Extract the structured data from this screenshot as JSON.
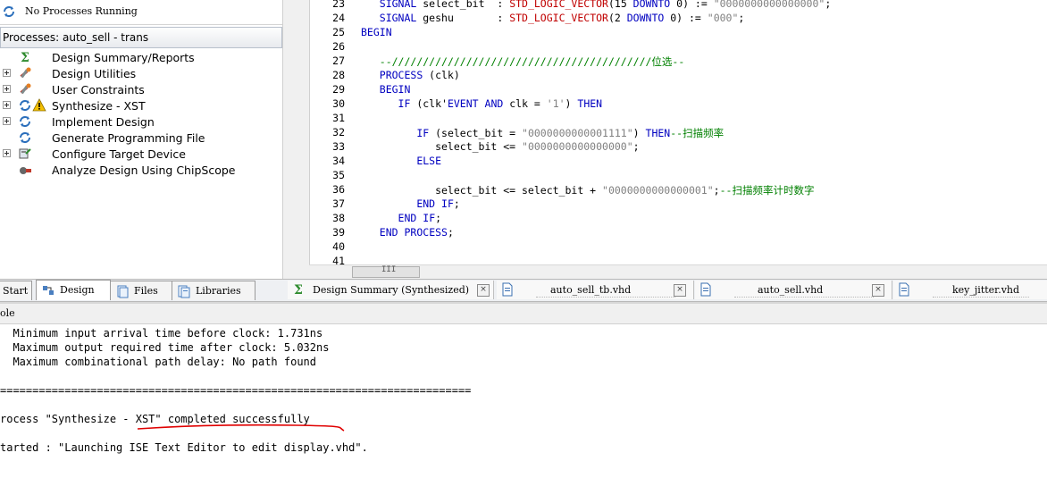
{
  "status": {
    "text": "No Processes Running"
  },
  "processes": {
    "header": "Processes: auto_sell - trans",
    "items": [
      {
        "label": "Design Summary/Reports",
        "icon": "sigma-icon",
        "expandable": false
      },
      {
        "label": "Design Utilities",
        "icon": "tools-icon",
        "expandable": true
      },
      {
        "label": "User Constraints",
        "icon": "tools-icon",
        "expandable": true
      },
      {
        "label": "Synthesize - XST",
        "icon": "refresh-icon",
        "expandable": true,
        "warning": true
      },
      {
        "label": "Implement Design",
        "icon": "refresh-icon",
        "expandable": true
      },
      {
        "label": "Generate Programming File",
        "icon": "refresh-icon",
        "expandable": false
      },
      {
        "label": "Configure Target Device",
        "icon": "device-icon",
        "expandable": true
      },
      {
        "label": "Analyze Design Using ChipScope",
        "icon": "chipscope-icon",
        "expandable": false
      }
    ]
  },
  "editor": {
    "lines": [
      {
        "n": "23",
        "t": [
          [
            "   ",
            ""
          ],
          [
            "SIGNAL",
            "kw"
          ],
          [
            " select_bit  : ",
            ""
          ],
          [
            "STD_LOGIC_VECTOR",
            "ty"
          ],
          [
            "(15 ",
            ""
          ],
          [
            "DOWNTO",
            "kw"
          ],
          [
            " 0) := ",
            ""
          ],
          [
            "\"0000000000000000\"",
            "str"
          ],
          [
            ";",
            ""
          ]
        ]
      },
      {
        "n": "24",
        "t": [
          [
            "   ",
            ""
          ],
          [
            "SIGNAL",
            "kw"
          ],
          [
            " geshu       : ",
            ""
          ],
          [
            "STD_LOGIC_VECTOR",
            "ty"
          ],
          [
            "(2 ",
            ""
          ],
          [
            "DOWNTO",
            "kw"
          ],
          [
            " 0) := ",
            ""
          ],
          [
            "\"000\"",
            "str"
          ],
          [
            ";",
            ""
          ]
        ]
      },
      {
        "n": "25",
        "t": [
          [
            "BEGIN",
            "kw"
          ]
        ]
      },
      {
        "n": "26",
        "t": []
      },
      {
        "n": "27",
        "t": [
          [
            "   ",
            ""
          ],
          [
            "--//////////////////////////////////////////位选--",
            "cm"
          ]
        ]
      },
      {
        "n": "28",
        "t": [
          [
            "   ",
            ""
          ],
          [
            "PROCESS",
            "kw"
          ],
          [
            " (clk)",
            ""
          ]
        ]
      },
      {
        "n": "29",
        "t": [
          [
            "   ",
            ""
          ],
          [
            "BEGIN",
            "kw"
          ]
        ]
      },
      {
        "n": "30",
        "t": [
          [
            "      ",
            ""
          ],
          [
            "IF",
            "kw"
          ],
          [
            " (clk'",
            ""
          ],
          [
            "EVENT",
            "kw"
          ],
          [
            " ",
            ""
          ],
          [
            "AND",
            "kw"
          ],
          [
            " clk = ",
            ""
          ],
          [
            "'1'",
            "str"
          ],
          [
            ") ",
            ""
          ],
          [
            "THEN",
            "kw"
          ]
        ]
      },
      {
        "n": "31",
        "t": []
      },
      {
        "n": "32",
        "t": [
          [
            "         ",
            ""
          ],
          [
            "IF",
            "kw"
          ],
          [
            " (select_bit = ",
            ""
          ],
          [
            "\"0000000000001111\"",
            "str"
          ],
          [
            ") ",
            ""
          ],
          [
            "THEN",
            "kw"
          ],
          [
            "--扫描频率",
            "cm"
          ]
        ]
      },
      {
        "n": "33",
        "t": [
          [
            "            select_bit <= ",
            ""
          ],
          [
            "\"0000000000000000\"",
            "str"
          ],
          [
            ";",
            ""
          ]
        ]
      },
      {
        "n": "34",
        "t": [
          [
            "         ",
            ""
          ],
          [
            "ELSE",
            "kw"
          ]
        ]
      },
      {
        "n": "35",
        "t": []
      },
      {
        "n": "36",
        "t": [
          [
            "            select_bit <= select_bit + ",
            ""
          ],
          [
            "\"0000000000000001\"",
            "str"
          ],
          [
            ";",
            ""
          ],
          [
            "--扫描频率计时数字",
            "cm"
          ]
        ]
      },
      {
        "n": "37",
        "t": [
          [
            "         ",
            ""
          ],
          [
            "END",
            "kw"
          ],
          [
            " ",
            ""
          ],
          [
            "IF",
            "kw"
          ],
          [
            ";",
            ""
          ]
        ]
      },
      {
        "n": "38",
        "t": [
          [
            "      ",
            ""
          ],
          [
            "END",
            "kw"
          ],
          [
            " ",
            ""
          ],
          [
            "IF",
            "kw"
          ],
          [
            ";",
            ""
          ]
        ]
      },
      {
        "n": "39",
        "t": [
          [
            "   ",
            ""
          ],
          [
            "END",
            "kw"
          ],
          [
            " ",
            ""
          ],
          [
            "PROCESS",
            "kw"
          ],
          [
            ";",
            ""
          ]
        ]
      },
      {
        "n": "40",
        "t": []
      },
      {
        "n": "41",
        "t": []
      }
    ],
    "scroll_grip": "III"
  },
  "left_tabs": [
    {
      "label": "Start",
      "icon": "",
      "active": false
    },
    {
      "label": "Design",
      "icon": "design-icon",
      "active": true
    },
    {
      "label": "Files",
      "icon": "files-icon",
      "active": false
    },
    {
      "label": "Libraries",
      "icon": "libraries-icon",
      "active": false
    }
  ],
  "editor_tabs": [
    {
      "label": "Design Summary (Synthesized)",
      "icon": "sigma-icon"
    },
    {
      "label": "auto_sell_tb.vhd",
      "icon": "document-icon"
    },
    {
      "label": "auto_sell.vhd",
      "icon": "document-icon"
    },
    {
      "label": "key_jitter.vhd",
      "icon": "document-icon"
    }
  ],
  "console": {
    "header": "ole",
    "lines": [
      "  Minimum input arrival time before clock: 1.731ns",
      "  Maximum output required time after clock: 5.032ns",
      "  Maximum combinational path delay: No path found",
      "",
      "=========================================================================",
      "",
      "rocess \"Synthesize - XST\" completed successfully",
      "",
      "tarted : \"Launching ISE Text Editor to edit display.vhd\"."
    ]
  },
  "colors": {
    "keyword": "#0000c0",
    "string": "#808080",
    "comment": "#008000",
    "type": "#c00000",
    "underline": "#e00000"
  }
}
